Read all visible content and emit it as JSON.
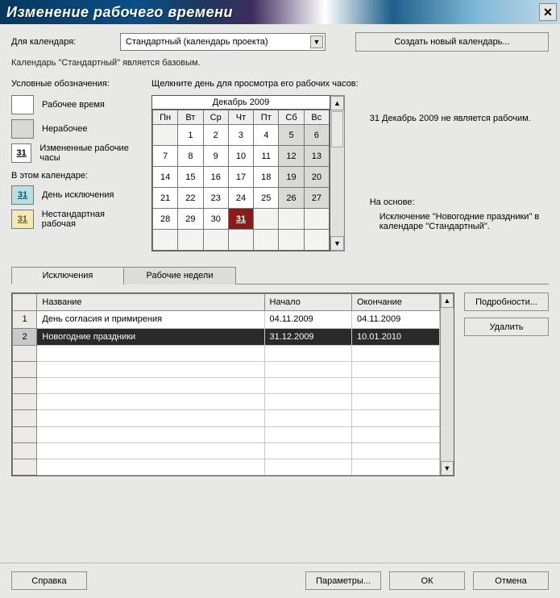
{
  "title": "Изменение рабочего времени",
  "forCalendarLabel": "Для календаря:",
  "calendarCombo": "Стандартный (календарь проекта)",
  "newCalBtn": "Создать новый календарь...",
  "baseNote": "Календарь \"Стандартный\" является базовым.",
  "legendTitle": "Условные обозначения:",
  "clickHint": "Щелкните день для просмотра его рабочих часов:",
  "legend": {
    "work": "Рабочее время",
    "nonwork": "Нерабочее",
    "edited": "Измененные рабочие часы",
    "editedNum": "31",
    "inThis": "В этом календаре:",
    "excDay": "День исключения",
    "excNum": "31",
    "nonstd": "Нестандартная рабочая",
    "nonstdNum": "31"
  },
  "cal": {
    "month": "Декабрь 2009",
    "dow": [
      "Пн",
      "Вт",
      "Ср",
      "Чт",
      "Пт",
      "Сб",
      "Вс"
    ],
    "weeks": [
      [
        {
          "d": "",
          "we": false,
          "e": true
        },
        {
          "d": "1",
          "we": false
        },
        {
          "d": "2",
          "we": false
        },
        {
          "d": "3",
          "we": false
        },
        {
          "d": "4",
          "we": false
        },
        {
          "d": "5",
          "we": true
        },
        {
          "d": "6",
          "we": true
        }
      ],
      [
        {
          "d": "7",
          "we": false
        },
        {
          "d": "8",
          "we": false
        },
        {
          "d": "9",
          "we": false
        },
        {
          "d": "10",
          "we": false
        },
        {
          "d": "11",
          "we": false
        },
        {
          "d": "12",
          "we": true
        },
        {
          "d": "13",
          "we": true
        }
      ],
      [
        {
          "d": "14",
          "we": false
        },
        {
          "d": "15",
          "we": false
        },
        {
          "d": "16",
          "we": false
        },
        {
          "d": "17",
          "we": false
        },
        {
          "d": "18",
          "we": false
        },
        {
          "d": "19",
          "we": true
        },
        {
          "d": "20",
          "we": true
        }
      ],
      [
        {
          "d": "21",
          "we": false
        },
        {
          "d": "22",
          "we": false
        },
        {
          "d": "23",
          "we": false
        },
        {
          "d": "24",
          "we": false
        },
        {
          "d": "25",
          "we": false
        },
        {
          "d": "26",
          "we": true
        },
        {
          "d": "27",
          "we": true
        }
      ],
      [
        {
          "d": "28",
          "we": false
        },
        {
          "d": "29",
          "we": false
        },
        {
          "d": "30",
          "we": false
        },
        {
          "d": "31",
          "we": false,
          "sel": true
        },
        {
          "d": "",
          "we": false,
          "e": true
        },
        {
          "d": "",
          "we": true,
          "e": true
        },
        {
          "d": "",
          "we": true,
          "e": true
        }
      ],
      [
        {
          "d": "",
          "e": true
        },
        {
          "d": "",
          "e": true
        },
        {
          "d": "",
          "e": true
        },
        {
          "d": "",
          "e": true
        },
        {
          "d": "",
          "e": true
        },
        {
          "d": "",
          "e": true
        },
        {
          "d": "",
          "e": true
        }
      ]
    ]
  },
  "info": {
    "line1": "31 Декабрь 2009 не является рабочим.",
    "basisTitle": "На основе:",
    "basisText": "Исключение \"Новогодние праздники\" в календаре \"Стандартный\"."
  },
  "tabs": {
    "exceptions": "Исключения",
    "workweeks": "Рабочие недели"
  },
  "grid": {
    "cols": {
      "name": "Название",
      "start": "Начало",
      "end": "Окончание"
    },
    "rows": [
      {
        "n": "1",
        "name": "День согласия и примирения",
        "start": "04.11.2009",
        "end": "04.11.2009",
        "sel": false
      },
      {
        "n": "2",
        "name": "Новогодние праздники",
        "start": "31.12.2009",
        "end": "10.01.2010",
        "sel": true
      }
    ]
  },
  "buttons": {
    "details": "Подробности...",
    "delete": "Удалить",
    "help": "Справка",
    "options": "Параметры...",
    "ok": "ОК",
    "cancel": "Отмена"
  }
}
